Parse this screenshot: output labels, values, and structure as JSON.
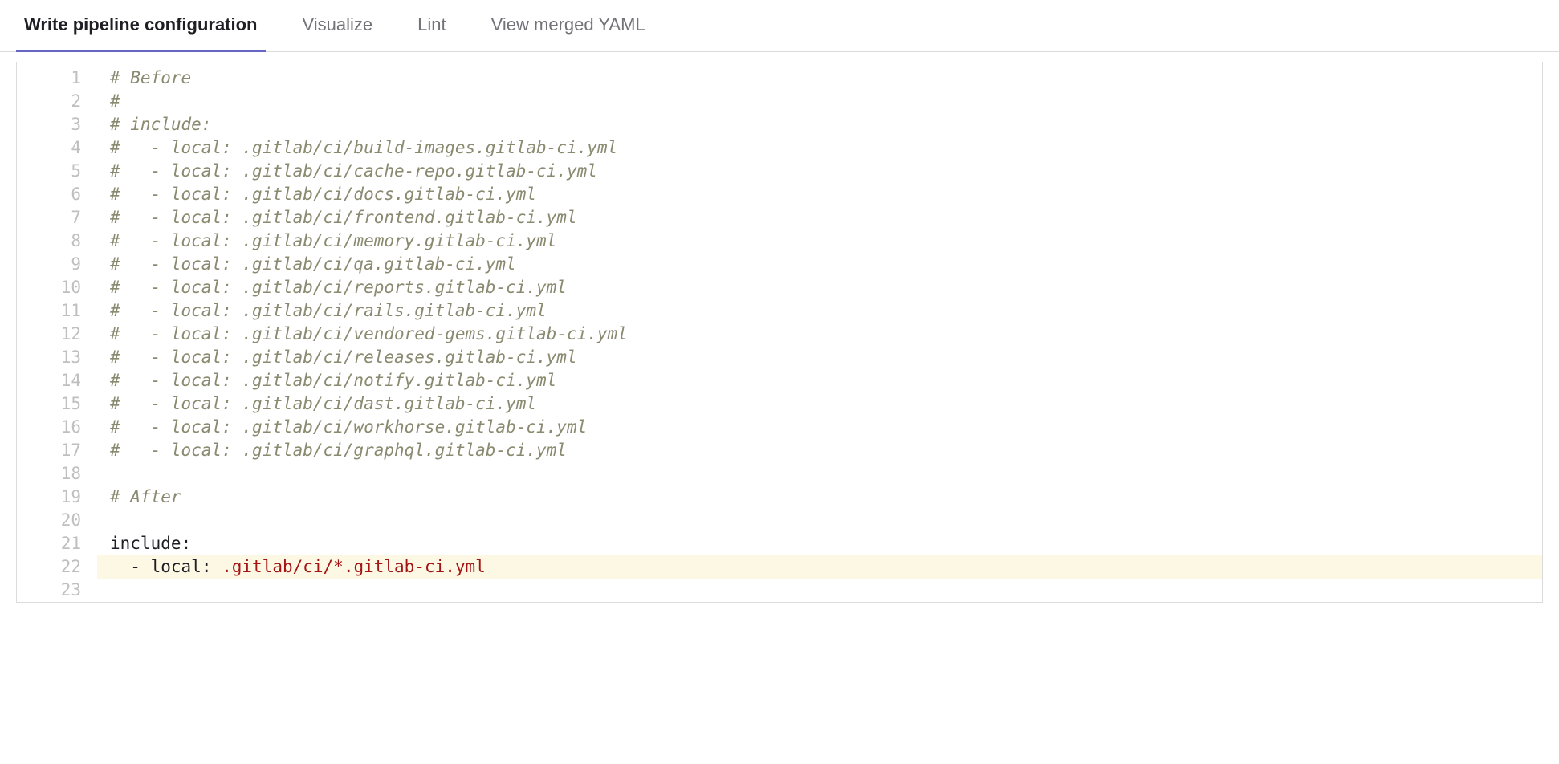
{
  "tabs": [
    {
      "label": "Write pipeline configuration",
      "active": true
    },
    {
      "label": "Visualize",
      "active": false
    },
    {
      "label": "Lint",
      "active": false
    },
    {
      "label": "View merged YAML",
      "active": false
    }
  ],
  "editor": {
    "lines": [
      {
        "n": 1,
        "tokens": [
          {
            "t": "# Before",
            "c": "comment"
          }
        ]
      },
      {
        "n": 2,
        "tokens": [
          {
            "t": "#",
            "c": "comment"
          }
        ]
      },
      {
        "n": 3,
        "tokens": [
          {
            "t": "# include:",
            "c": "comment"
          }
        ]
      },
      {
        "n": 4,
        "tokens": [
          {
            "t": "#   - local: .gitlab/ci/build-images.gitlab-ci.yml",
            "c": "comment"
          }
        ]
      },
      {
        "n": 5,
        "tokens": [
          {
            "t": "#   - local: .gitlab/ci/cache-repo.gitlab-ci.yml",
            "c": "comment"
          }
        ]
      },
      {
        "n": 6,
        "tokens": [
          {
            "t": "#   - local: .gitlab/ci/docs.gitlab-ci.yml",
            "c": "comment"
          }
        ]
      },
      {
        "n": 7,
        "tokens": [
          {
            "t": "#   - local: .gitlab/ci/frontend.gitlab-ci.yml",
            "c": "comment"
          }
        ]
      },
      {
        "n": 8,
        "tokens": [
          {
            "t": "#   - local: .gitlab/ci/memory.gitlab-ci.yml",
            "c": "comment"
          }
        ]
      },
      {
        "n": 9,
        "tokens": [
          {
            "t": "#   - local: .gitlab/ci/qa.gitlab-ci.yml",
            "c": "comment"
          }
        ]
      },
      {
        "n": 10,
        "tokens": [
          {
            "t": "#   - local: .gitlab/ci/reports.gitlab-ci.yml",
            "c": "comment"
          }
        ]
      },
      {
        "n": 11,
        "tokens": [
          {
            "t": "#   - local: .gitlab/ci/rails.gitlab-ci.yml",
            "c": "comment"
          }
        ]
      },
      {
        "n": 12,
        "tokens": [
          {
            "t": "#   - local: .gitlab/ci/vendored-gems.gitlab-ci.yml",
            "c": "comment"
          }
        ]
      },
      {
        "n": 13,
        "tokens": [
          {
            "t": "#   - local: .gitlab/ci/releases.gitlab-ci.yml",
            "c": "comment"
          }
        ]
      },
      {
        "n": 14,
        "tokens": [
          {
            "t": "#   - local: .gitlab/ci/notify.gitlab-ci.yml",
            "c": "comment"
          }
        ]
      },
      {
        "n": 15,
        "tokens": [
          {
            "t": "#   - local: .gitlab/ci/dast.gitlab-ci.yml",
            "c": "comment"
          }
        ]
      },
      {
        "n": 16,
        "tokens": [
          {
            "t": "#   - local: .gitlab/ci/workhorse.gitlab-ci.yml",
            "c": "comment"
          }
        ]
      },
      {
        "n": 17,
        "tokens": [
          {
            "t": "#   - local: .gitlab/ci/graphql.gitlab-ci.yml",
            "c": "comment"
          }
        ]
      },
      {
        "n": 18,
        "tokens": [
          {
            "t": "",
            "c": "plain"
          }
        ]
      },
      {
        "n": 19,
        "tokens": [
          {
            "t": "# After",
            "c": "comment"
          }
        ]
      },
      {
        "n": 20,
        "tokens": [
          {
            "t": "",
            "c": "plain"
          }
        ]
      },
      {
        "n": 21,
        "tokens": [
          {
            "t": "include",
            "c": "key"
          },
          {
            "t": ":",
            "c": "punc"
          }
        ]
      },
      {
        "n": 22,
        "hl": true,
        "tokens": [
          {
            "t": "  ",
            "c": "plain"
          },
          {
            "t": "- ",
            "c": "punc"
          },
          {
            "t": "local",
            "c": "key"
          },
          {
            "t": ": ",
            "c": "punc"
          },
          {
            "t": ".gitlab/ci/*.gitlab-ci.yml",
            "c": "string"
          }
        ]
      },
      {
        "n": 23,
        "tokens": [
          {
            "t": "",
            "c": "plain"
          }
        ]
      }
    ]
  }
}
